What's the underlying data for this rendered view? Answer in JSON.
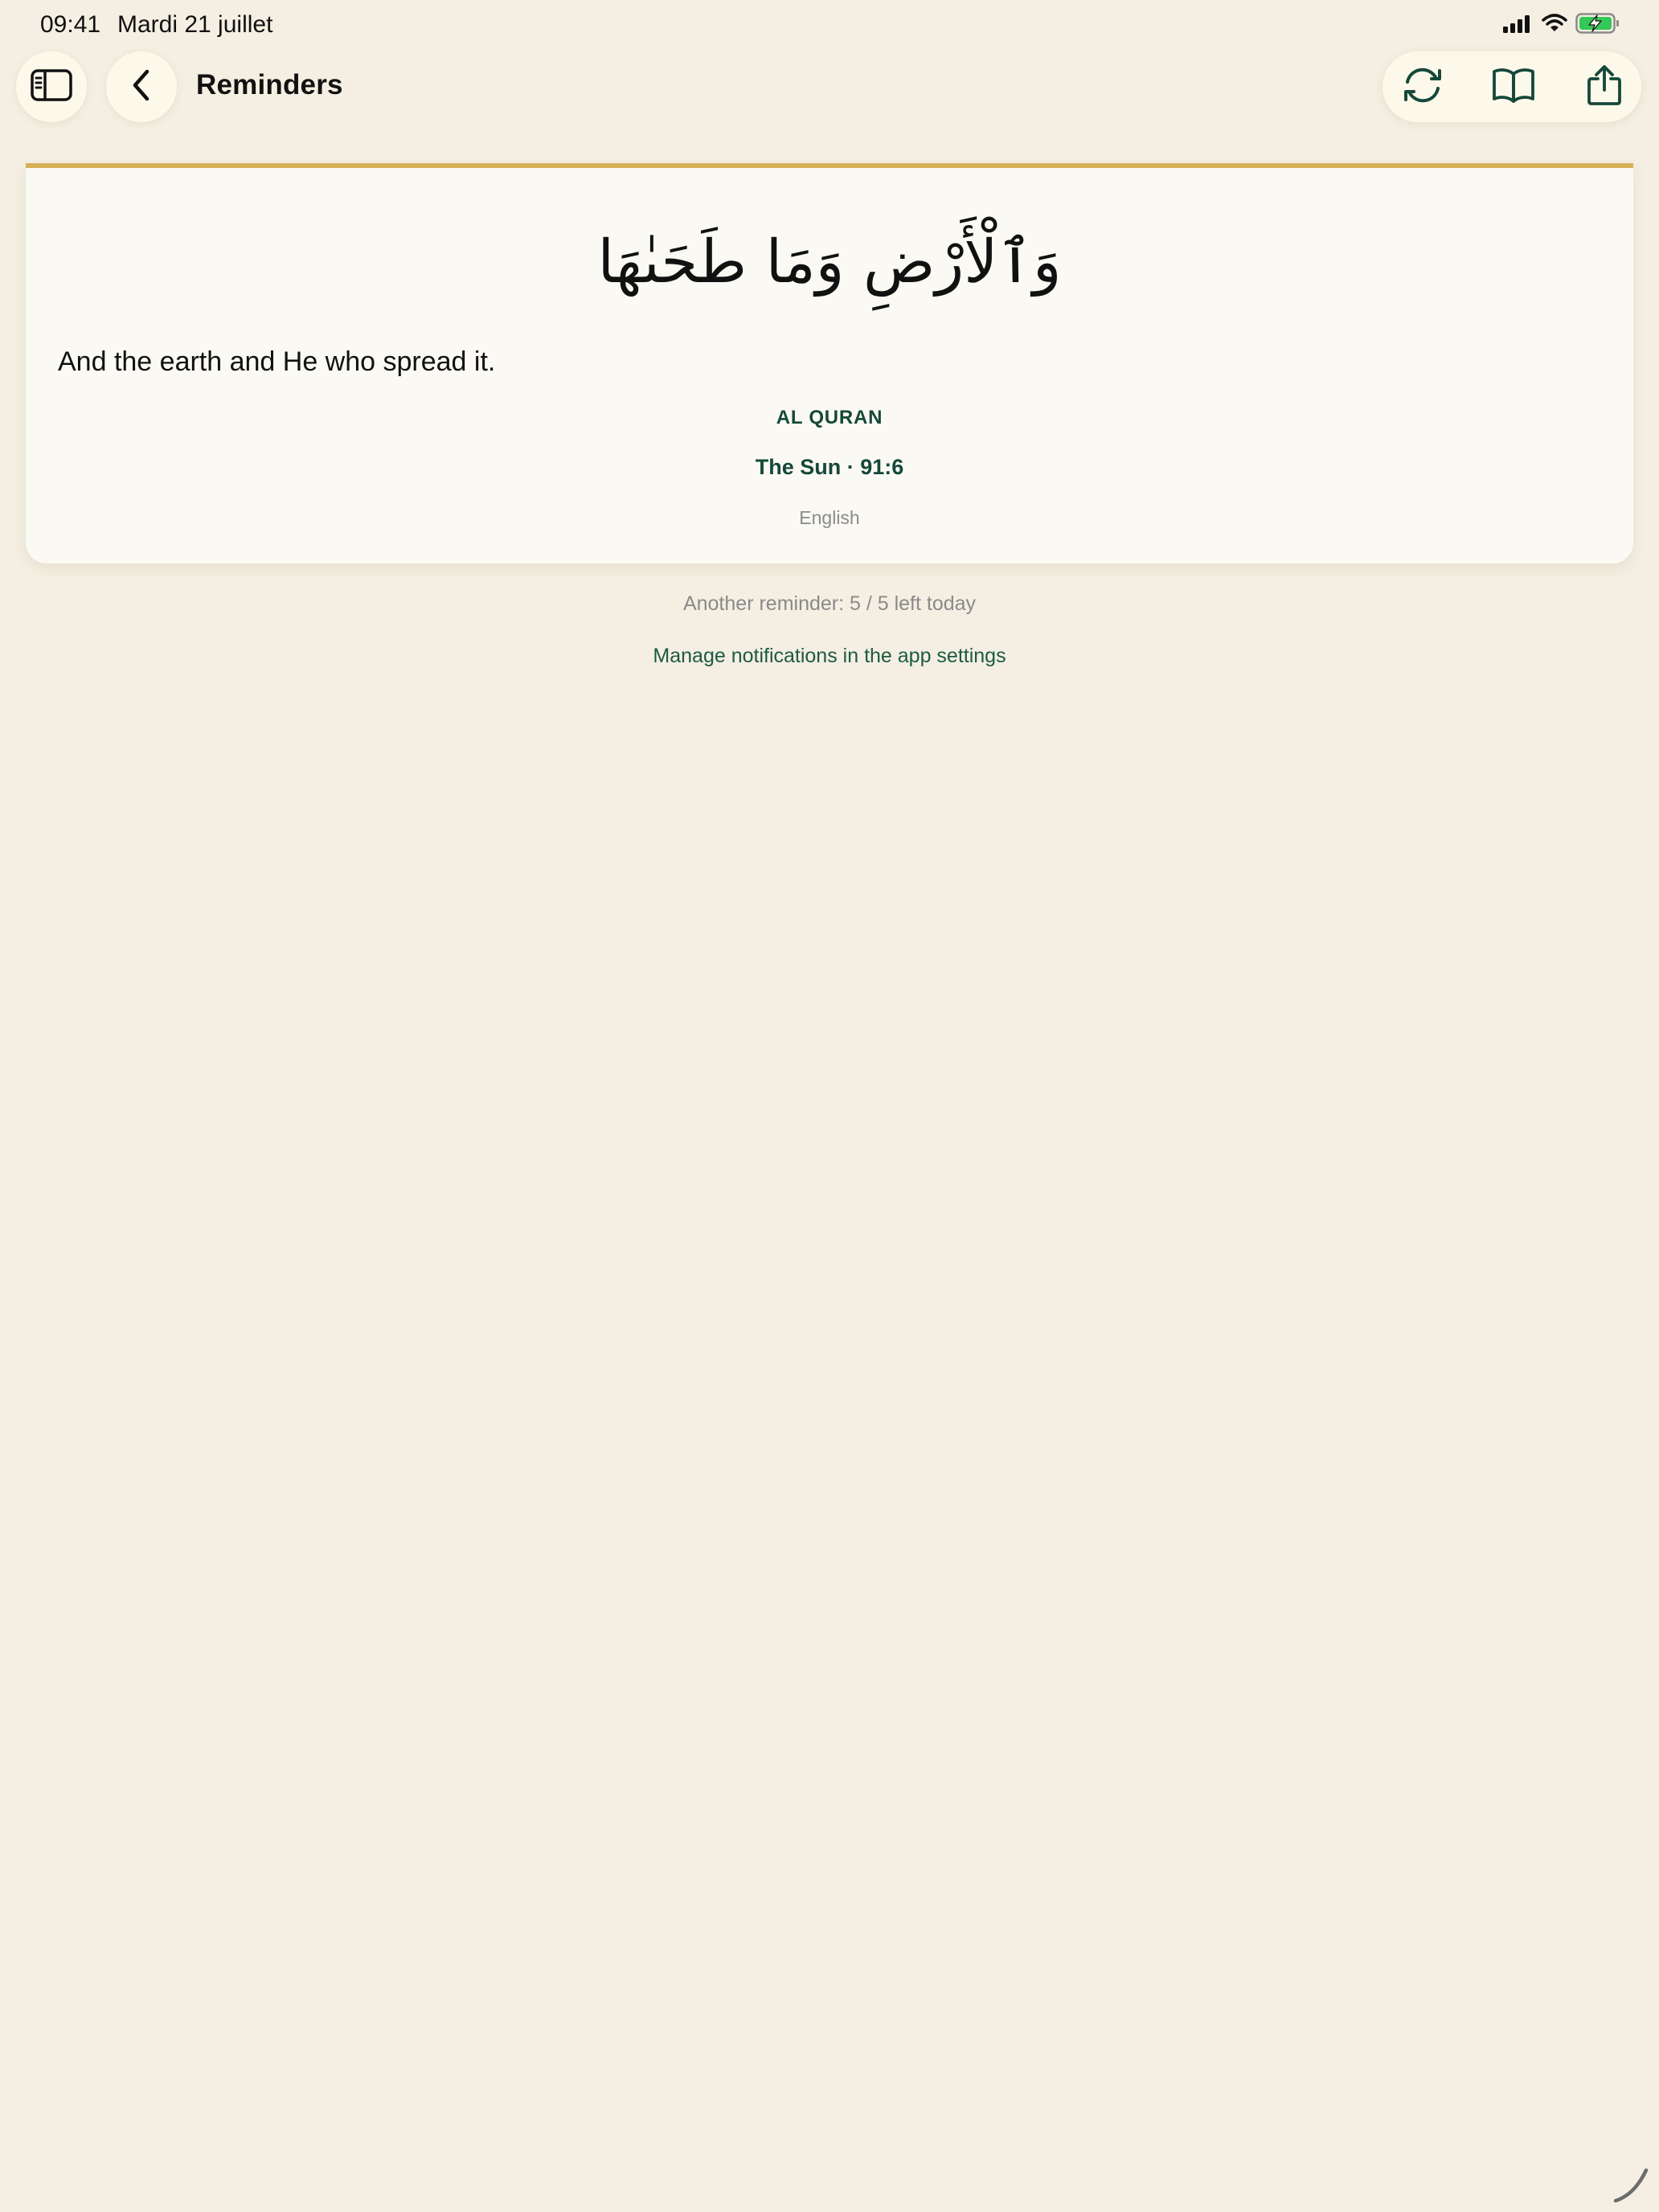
{
  "status_bar": {
    "time": "09:41",
    "date": "Mardi 21 juillet",
    "icons": [
      "cellular-signal-icon",
      "wifi-icon",
      "battery-charging-icon"
    ]
  },
  "toolbar": {
    "title": "Reminders",
    "left_icons": [
      "sidebar-icon",
      "chevron-left-icon"
    ],
    "right_icons": [
      "refresh-icon",
      "book-icon",
      "share-icon"
    ]
  },
  "reminder": {
    "arabic": "وَٱلْأَرْضِ وَمَا طَحَىٰهَا",
    "translation": "And the earth and He who spread it.",
    "source": "AL QURAN",
    "reference": "The Sun · 91:6",
    "language": "English"
  },
  "footer": {
    "remaining": "Another reminder: 5 / 5 left today",
    "settings_link": "Manage notifications in the app settings"
  },
  "colors": {
    "background": "#f4efe2",
    "card": "#fbf9f3",
    "accent_gold": "#d8ae58",
    "accent_green": "#15483a",
    "button_fill": "#fdf9ea",
    "battery_green": "#34c759"
  }
}
